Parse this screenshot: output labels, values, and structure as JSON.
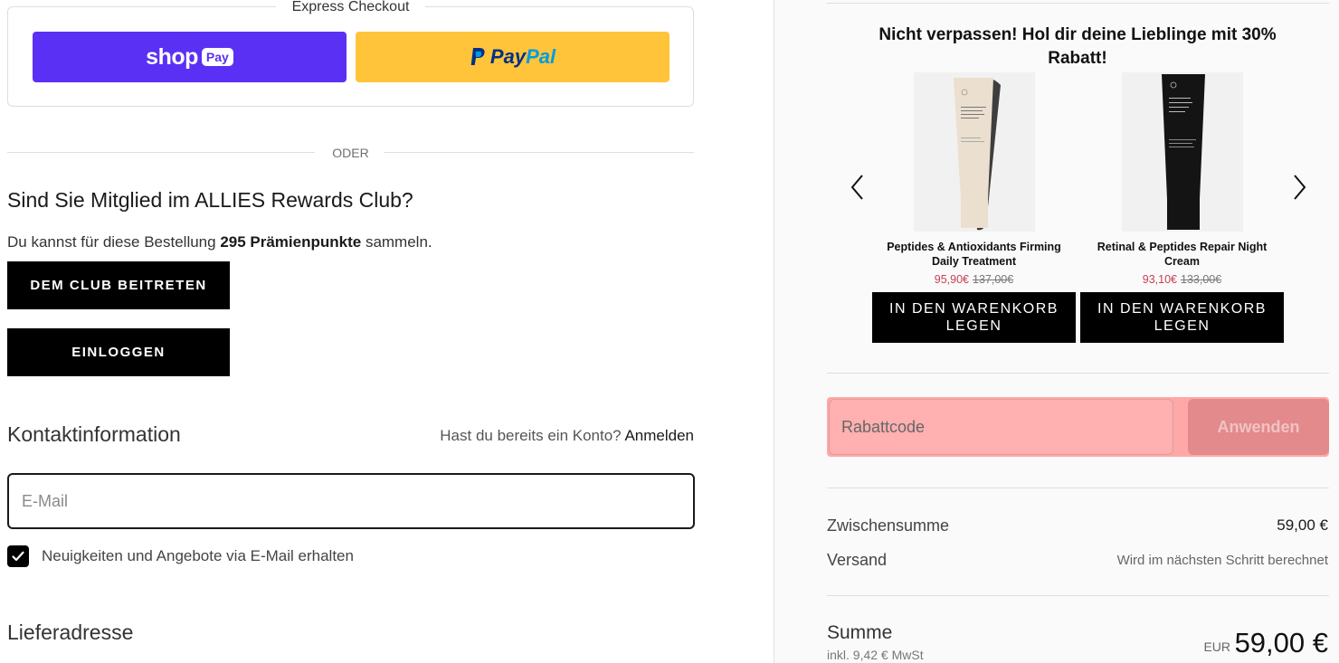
{
  "express": {
    "title": "Express Checkout",
    "shoppay_word": "shop",
    "shoppay_pill": "Pay",
    "paypal_pay": "Pay",
    "paypal_pal": "Pal"
  },
  "divider": {
    "oder": "ODER"
  },
  "rewards": {
    "title": "Sind Sie Mitglied im ALLIES Rewards Club?",
    "sub_prefix": "Du kannst für diese Bestellung ",
    "sub_points": "295 Prämienpunkte",
    "sub_suffix": " sammeln.",
    "join_label": "DEM CLUB BEITRETEN",
    "login_label": "EINLOGGEN"
  },
  "contact": {
    "title": "Kontaktinformation",
    "have_account": "Hast du bereits ein Konto?",
    "login_link": "Anmelden",
    "email_placeholder": "E-Mail",
    "newsletter_label": "Neuigkeiten und Angebote via E-Mail erhalten",
    "newsletter_checked": true
  },
  "shipping": {
    "title": "Lieferadresse"
  },
  "upsell": {
    "title": "Nicht verpassen! Hol dir deine Lieblinge mit 30% Rabatt!",
    "products": [
      {
        "name": "Peptides & Antioxidants Firming Daily Treatment",
        "price_new": "95,90€",
        "price_old": "137,00€",
        "button": "IN DEN WARENKORB LEGEN",
        "tube_color": "#ece1d2"
      },
      {
        "name": "Retinal & Peptides Repair Night Cream",
        "price_new": "93,10€",
        "price_old": "133,00€",
        "button": "IN DEN WARENKORB LEGEN",
        "tube_color": "#141414"
      }
    ]
  },
  "discount": {
    "placeholder": "Rabattcode",
    "apply_label": "Anwenden"
  },
  "summary": {
    "subtotal_label": "Zwischensumme",
    "subtotal_value": "59,00 €",
    "shipping_label": "Versand",
    "shipping_value": "Wird im nächsten Schritt berechnet",
    "total_label": "Summe",
    "tax_note": "inkl. 9,42 € MwSt",
    "currency": "EUR",
    "total_value": "59,00 €"
  }
}
